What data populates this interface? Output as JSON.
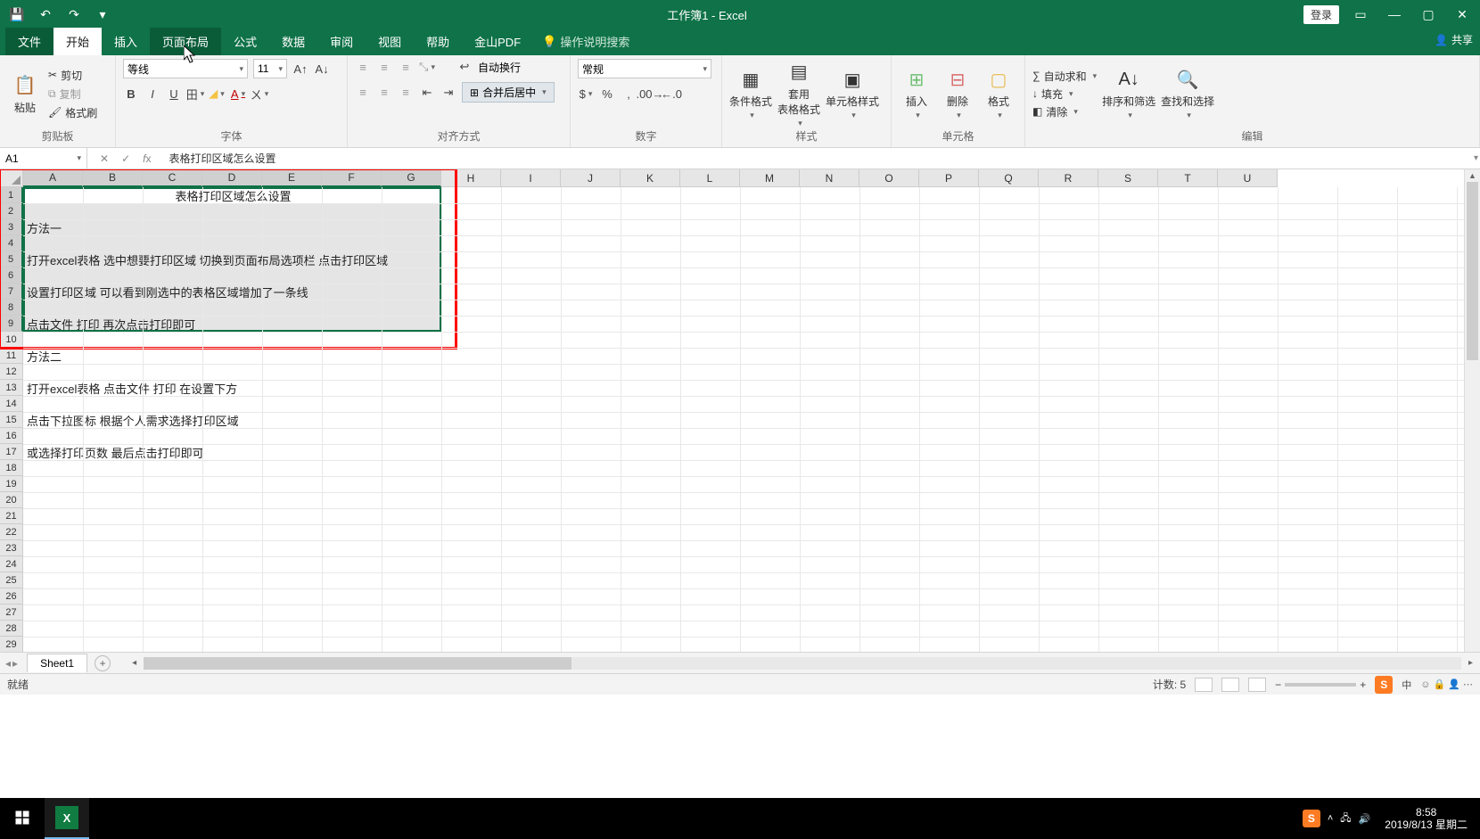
{
  "titlebar": {
    "title": "工作簿1 - Excel",
    "login": "登录"
  },
  "tabs": {
    "file": "文件",
    "home": "开始",
    "insert": "插入",
    "pagelayout": "页面布局",
    "formulas": "公式",
    "data": "数据",
    "review": "审阅",
    "view": "视图",
    "help": "帮助",
    "wps": "金山PDF",
    "tellme": "操作说明搜索",
    "share": "共享"
  },
  "ribbon": {
    "clipboard": {
      "label": "剪贴板",
      "paste": "粘贴",
      "cut": "剪切",
      "copy": "复制",
      "painter": "格式刷"
    },
    "font": {
      "label": "字体",
      "name": "等线",
      "size": "11"
    },
    "align": {
      "label": "对齐方式",
      "wrap": "自动换行",
      "merge": "合并后居中"
    },
    "number": {
      "label": "数字",
      "format": "常规"
    },
    "styles": {
      "label": "样式",
      "cond": "条件格式",
      "table": "套用\n表格格式",
      "cell": "单元格样式"
    },
    "cells": {
      "label": "单元格",
      "insert": "插入",
      "delete": "删除",
      "format": "格式"
    },
    "editing": {
      "label": "编辑",
      "sum": "自动求和",
      "fill": "填充",
      "clear": "清除",
      "sort": "排序和筛选",
      "find": "查找和选择"
    }
  },
  "fbar": {
    "name": "A1",
    "formula": "表格打印区域怎么设置"
  },
  "columns": [
    "A",
    "B",
    "C",
    "D",
    "E",
    "F",
    "G",
    "H",
    "I",
    "J",
    "K",
    "L",
    "M",
    "N",
    "O",
    "P",
    "Q",
    "R",
    "S",
    "T",
    "U"
  ],
  "rows": [
    "1",
    "2",
    "3",
    "4",
    "5",
    "6",
    "7",
    "8",
    "9",
    "10",
    "11",
    "12",
    "13",
    "14",
    "15",
    "16",
    "17",
    "18",
    "19",
    "20",
    "21",
    "22",
    "23",
    "24",
    "25",
    "26",
    "27",
    "28",
    "29"
  ],
  "selectedCols": 7,
  "selectedRows": 9,
  "cellA1": "表格打印区域怎么设置",
  "cellA3": "方法一",
  "cellA5": "打开excel表格  选中想要打印区域  切换到页面布局选项栏  点击打印区域",
  "cellA7": "设置打印区域  可以看到刚选中的表格区域增加了一条线",
  "cellA9": "点击文件  打印 再次点击打印即可",
  "cellA11": "方法二",
  "cellA13": "打开excel表格  点击文件  打印  在设置下方",
  "cellA15": "点击下拉图标  根据个人需求选择打印区域",
  "cellA17": "或选择打印页数  最后点击打印即可",
  "sheettab": {
    "name": "Sheet1"
  },
  "status": {
    "ready": "就绪",
    "count": "计数: 5"
  },
  "clock": {
    "time": "8:58",
    "date": "2019/8/13 星期二"
  },
  "tray": {
    "ime": "中"
  }
}
